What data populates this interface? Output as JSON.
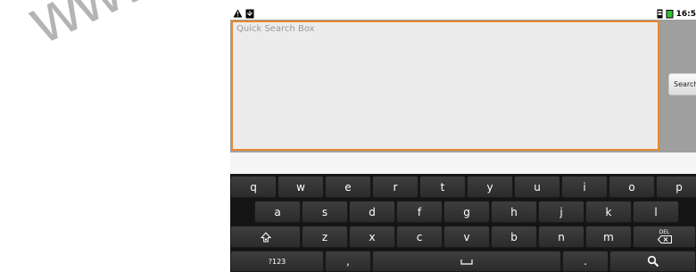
{
  "watermark": {
    "text": "www.w"
  },
  "statusbar": {
    "time": "16:5",
    "icons": [
      "warning-icon",
      "usb-icon",
      "sim-icon",
      "battery-icon"
    ]
  },
  "search": {
    "placeholder": "Quick Search Box",
    "button_label": "Search"
  },
  "keyboard": {
    "row1": [
      "q",
      "w",
      "e",
      "r",
      "t",
      "y",
      "u",
      "i",
      "o",
      "p"
    ],
    "row2": [
      "a",
      "s",
      "d",
      "f",
      "g",
      "h",
      "j",
      "k",
      "l"
    ],
    "row3": [
      "z",
      "x",
      "c",
      "v",
      "b",
      "n",
      "m"
    ],
    "shift_icon": "shift-icon",
    "delete_label": "DEL",
    "symbols_label": "?123",
    "comma_label": ",",
    "period_label": ".",
    "space_icon": "space-icon",
    "search_icon": "search-icon"
  },
  "colors": {
    "accent": "#e7892c",
    "keyboard_bg": "#141414",
    "key_bg": "#333333",
    "search_area_bg": "#9f9f9f"
  }
}
